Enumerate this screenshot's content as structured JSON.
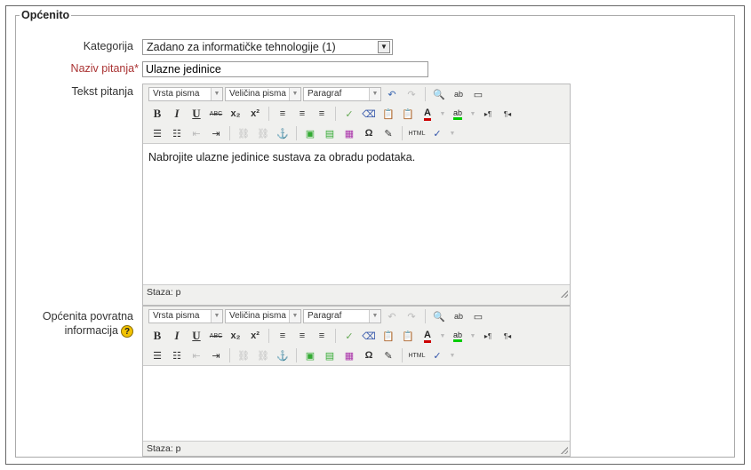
{
  "section": {
    "legend": "Općenito"
  },
  "fields": {
    "category": {
      "label": "Kategorija",
      "value": "Zadano za informatičke tehnologije (1)"
    },
    "name": {
      "label": "Naziv pitanja",
      "required_mark": "*",
      "value": "Ulazne jedinice"
    },
    "text": {
      "label": "Tekst pitanja",
      "content": "Nabrojite ulazne jedinice sustava za obradu podataka.",
      "status": "Staza: p"
    },
    "feedback": {
      "label_line1": "Općenita povratna",
      "label_line2": "informacija",
      "content": "",
      "status": "Staza: p"
    }
  },
  "toolbar": {
    "font_family": "Vrsta pisma",
    "font_size": "Veličina pisma",
    "format": "Paragraf",
    "bold": "B",
    "italic": "I",
    "underline": "U",
    "strike": "ABC",
    "subscript": "x₂",
    "superscript": "x²",
    "omega": "Ω",
    "html": "HTML"
  },
  "icons": {
    "help": "?"
  },
  "colors": {
    "required": "#aa3333",
    "help_icon": "#f2c200"
  }
}
